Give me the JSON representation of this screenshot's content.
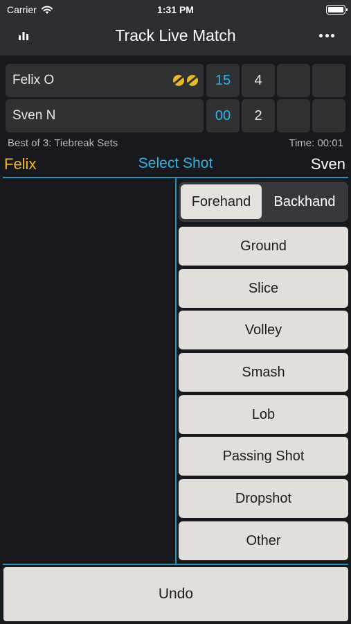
{
  "status": {
    "carrier": "Carrier",
    "time": "1:31 PM"
  },
  "nav": {
    "title": "Track Live Match",
    "left_icon": "stats-chart-icon",
    "right_icon": "more-icon"
  },
  "score": {
    "players": [
      {
        "name": "Felix O",
        "points": "15",
        "sets": [
          "4",
          "",
          ""
        ],
        "serving_balls": 2
      },
      {
        "name": "Sven N",
        "points": "00",
        "sets": [
          "2",
          "",
          ""
        ],
        "serving_balls": 0
      }
    ],
    "format": "Best of 3: Tiebreak Sets",
    "time": "Time: 00:01"
  },
  "shot_panel": {
    "left_player": "Felix",
    "prompt": "Select Shot",
    "right_player": "Sven",
    "side_options": [
      "Forehand",
      "Backhand"
    ],
    "selected_side": "Forehand",
    "shots": [
      "Ground",
      "Slice",
      "Volley",
      "Smash",
      "Lob",
      "Passing Shot",
      "Dropshot",
      "Other"
    ]
  },
  "undo_label": "Undo",
  "colors": {
    "accent_blue": "#2eb4e6",
    "accent_yellow": "#f0b716",
    "button_bg": "#e2ded9",
    "background": "#17191c"
  }
}
